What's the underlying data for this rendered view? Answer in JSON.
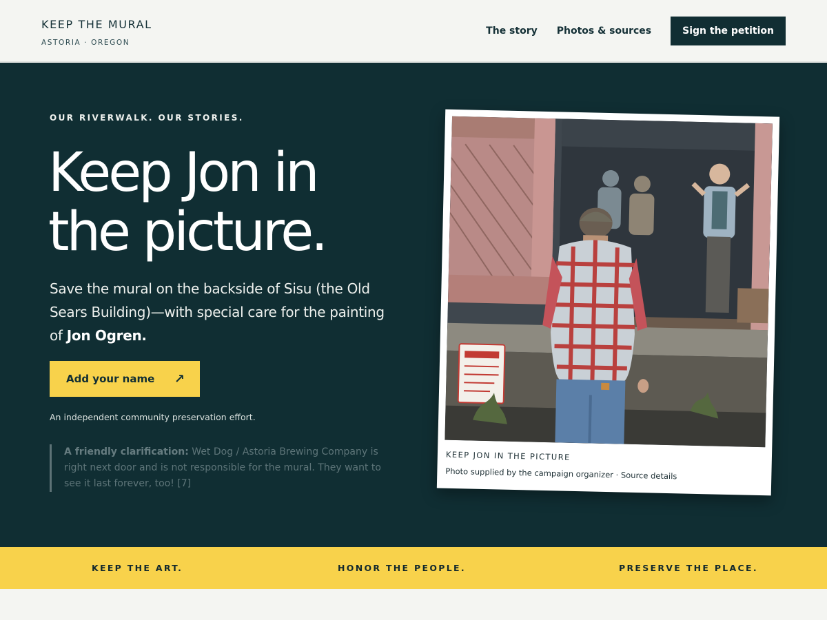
{
  "header": {
    "brand_title": "KEEP THE MURAL",
    "brand_subtitle": "ASTORIA · OREGON",
    "nav": {
      "story": "The story",
      "photos": "Photos & sources",
      "petition": "Sign the petition"
    }
  },
  "hero": {
    "eyebrow": "OUR RIVERWALK. OUR STORIES.",
    "headline_line1": "Keep Jon in",
    "headline_line2": "the picture.",
    "lede_text": "Save the mural on the backside of Sisu (the Old Sears Building)—with special care for the painting of ",
    "lede_emphasis": "Jon Ogren.",
    "cta_label": "Add your name",
    "cta_icon": "arrow-up-right-icon",
    "independent_note": "An independent community preservation effort.",
    "clarification_label": "A friendly clarification:",
    "clarification_text": " Wet Dog / Astoria Brewing Company is right next door and is not responsible for the mural. They want to see it last forever, too! [7]"
  },
  "photo": {
    "caption_title": "KEEP JON IN THE PICTURE",
    "caption_credit": "Photo supplied by the campaign organizer · ",
    "caption_link": "Source details",
    "sign_text": "PARKING FOR PERMIT HOLDERS ONLY"
  },
  "banner": {
    "item1": "KEEP THE ART.",
    "item2": "HONOR THE PEOPLE.",
    "item3": "PRESERVE THE PLACE."
  },
  "colors": {
    "ink": "#112e33",
    "hero_bg": "#102e33",
    "accent": "#f8d24b",
    "paper": "#f4f5f2"
  }
}
